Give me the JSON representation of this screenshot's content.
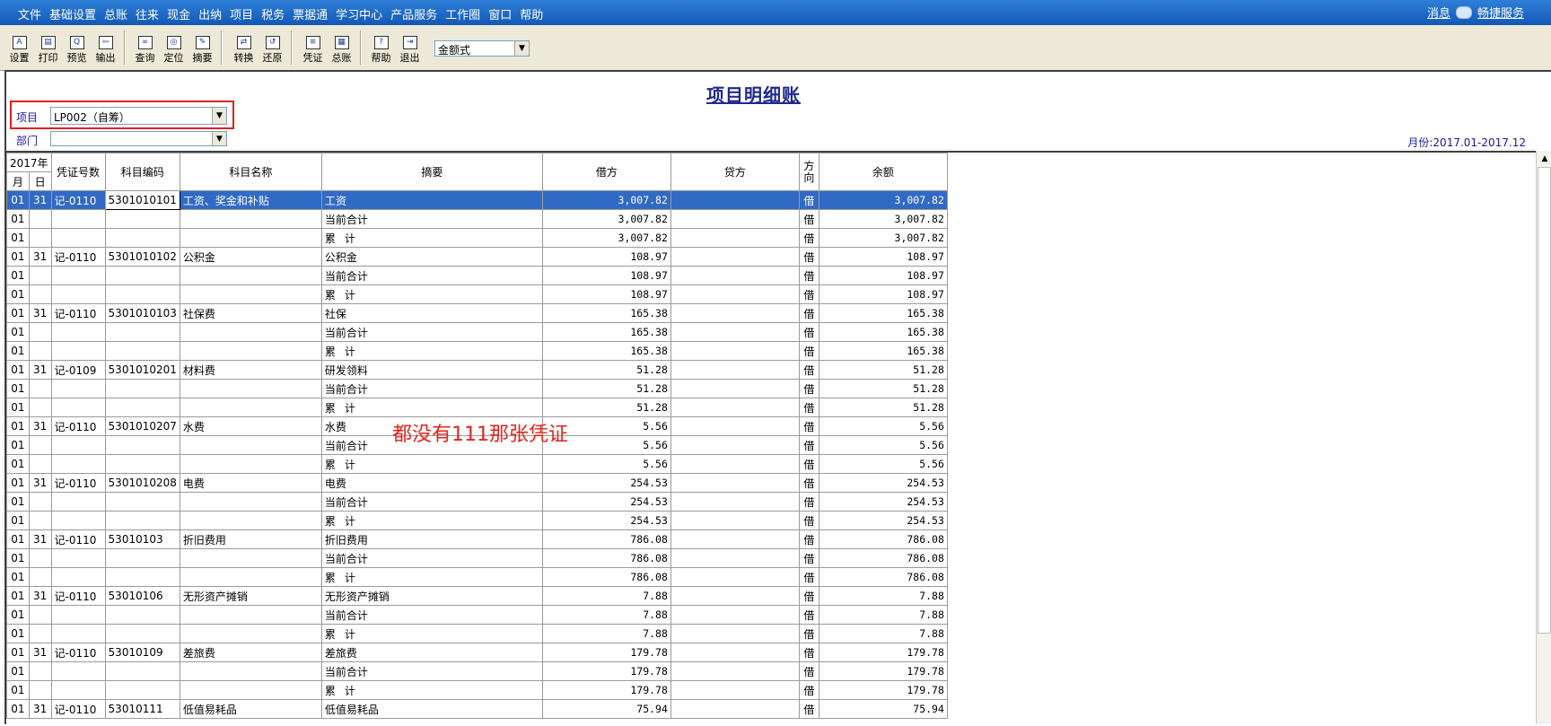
{
  "menu": {
    "items": [
      "文件",
      "基础设置",
      "总账",
      "往来",
      "现金",
      "出纳",
      "项目",
      "税务",
      "票据通",
      "学习中心",
      "产品服务",
      "工作圈",
      "窗口",
      "帮助"
    ],
    "right_message": "消息",
    "right_service": "畅捷服务"
  },
  "toolbar": {
    "groups": [
      [
        {
          "label": "设置",
          "icon": "settings-icon"
        },
        {
          "label": "打印",
          "icon": "print-icon"
        },
        {
          "label": "预览",
          "icon": "preview-icon"
        },
        {
          "label": "输出",
          "icon": "export-icon"
        }
      ],
      [
        {
          "label": "查询",
          "icon": "binoculars-icon"
        },
        {
          "label": "定位",
          "icon": "locate-icon"
        },
        {
          "label": "摘要",
          "icon": "summary-icon"
        }
      ],
      [
        {
          "label": "转换",
          "icon": "convert-icon"
        },
        {
          "label": "还原",
          "icon": "restore-icon"
        }
      ],
      [
        {
          "label": "凭证",
          "icon": "voucher-icon"
        },
        {
          "label": "总账",
          "icon": "ledger-icon"
        }
      ],
      [
        {
          "label": "帮助",
          "icon": "help-icon"
        },
        {
          "label": "退出",
          "icon": "exit-icon"
        }
      ]
    ],
    "format_select": "金额式"
  },
  "report": {
    "title": "项目明细账",
    "project_label": "项目",
    "project_value": "LP002（自筹）",
    "dept_label": "部门",
    "dept_value": "",
    "period": "月份:2017.01-2017.12"
  },
  "annotation": "都没有111那张凭证",
  "table": {
    "year_header": "2017年",
    "month_header": "月",
    "day_header": "日",
    "headers": {
      "voucher": "凭证号数",
      "code": "科目编码",
      "name": "科目名称",
      "summary": "摘要",
      "debit": "借方",
      "credit": "贷方",
      "direction": "方向",
      "balance": "余额"
    },
    "rows": [
      {
        "m": "01",
        "d": "31",
        "v": "记-0110",
        "code": "5301010101",
        "name": "工资、奖金和补贴",
        "summary": "工资",
        "debit": "3,007.82",
        "credit": "",
        "dir": "借",
        "bal": "3,007.82",
        "selected": true
      },
      {
        "m": "01",
        "d": "",
        "v": "",
        "code": "",
        "name": "",
        "summary": "当前合计",
        "debit": "3,007.82",
        "credit": "",
        "dir": "借",
        "bal": "3,007.82"
      },
      {
        "m": "01",
        "d": "",
        "v": "",
        "code": "",
        "name": "",
        "summary": "累计",
        "spaced": true,
        "debit": "3,007.82",
        "credit": "",
        "dir": "借",
        "bal": "3,007.82"
      },
      {
        "m": "01",
        "d": "31",
        "v": "记-0110",
        "code": "5301010102",
        "name": "公积金",
        "summary": "公积金",
        "debit": "108.97",
        "credit": "",
        "dir": "借",
        "bal": "108.97"
      },
      {
        "m": "01",
        "d": "",
        "v": "",
        "code": "",
        "name": "",
        "summary": "当前合计",
        "debit": "108.97",
        "credit": "",
        "dir": "借",
        "bal": "108.97"
      },
      {
        "m": "01",
        "d": "",
        "v": "",
        "code": "",
        "name": "",
        "summary": "累计",
        "spaced": true,
        "debit": "108.97",
        "credit": "",
        "dir": "借",
        "bal": "108.97"
      },
      {
        "m": "01",
        "d": "31",
        "v": "记-0110",
        "code": "5301010103",
        "name": "社保费",
        "summary": "社保",
        "debit": "165.38",
        "credit": "",
        "dir": "借",
        "bal": "165.38"
      },
      {
        "m": "01",
        "d": "",
        "v": "",
        "code": "",
        "name": "",
        "summary": "当前合计",
        "debit": "165.38",
        "credit": "",
        "dir": "借",
        "bal": "165.38"
      },
      {
        "m": "01",
        "d": "",
        "v": "",
        "code": "",
        "name": "",
        "summary": "累计",
        "spaced": true,
        "debit": "165.38",
        "credit": "",
        "dir": "借",
        "bal": "165.38"
      },
      {
        "m": "01",
        "d": "31",
        "v": "记-0109",
        "code": "5301010201",
        "name": "材料费",
        "summary": "研发领料",
        "debit": "51.28",
        "credit": "",
        "dir": "借",
        "bal": "51.28"
      },
      {
        "m": "01",
        "d": "",
        "v": "",
        "code": "",
        "name": "",
        "summary": "当前合计",
        "debit": "51.28",
        "credit": "",
        "dir": "借",
        "bal": "51.28"
      },
      {
        "m": "01",
        "d": "",
        "v": "",
        "code": "",
        "name": "",
        "summary": "累计",
        "spaced": true,
        "debit": "51.28",
        "credit": "",
        "dir": "借",
        "bal": "51.28"
      },
      {
        "m": "01",
        "d": "31",
        "v": "记-0110",
        "code": "5301010207",
        "name": "水费",
        "summary": "水费",
        "debit": "5.56",
        "credit": "",
        "dir": "借",
        "bal": "5.56"
      },
      {
        "m": "01",
        "d": "",
        "v": "",
        "code": "",
        "name": "",
        "summary": "当前合计",
        "debit": "5.56",
        "credit": "",
        "dir": "借",
        "bal": "5.56"
      },
      {
        "m": "01",
        "d": "",
        "v": "",
        "code": "",
        "name": "",
        "summary": "累计",
        "spaced": true,
        "debit": "5.56",
        "credit": "",
        "dir": "借",
        "bal": "5.56"
      },
      {
        "m": "01",
        "d": "31",
        "v": "记-0110",
        "code": "5301010208",
        "name": "电费",
        "summary": "电费",
        "debit": "254.53",
        "credit": "",
        "dir": "借",
        "bal": "254.53"
      },
      {
        "m": "01",
        "d": "",
        "v": "",
        "code": "",
        "name": "",
        "summary": "当前合计",
        "debit": "254.53",
        "credit": "",
        "dir": "借",
        "bal": "254.53"
      },
      {
        "m": "01",
        "d": "",
        "v": "",
        "code": "",
        "name": "",
        "summary": "累计",
        "spaced": true,
        "debit": "254.53",
        "credit": "",
        "dir": "借",
        "bal": "254.53"
      },
      {
        "m": "01",
        "d": "31",
        "v": "记-0110",
        "code": "53010103",
        "name": "折旧费用",
        "summary": "折旧费用",
        "debit": "786.08",
        "credit": "",
        "dir": "借",
        "bal": "786.08"
      },
      {
        "m": "01",
        "d": "",
        "v": "",
        "code": "",
        "name": "",
        "summary": "当前合计",
        "debit": "786.08",
        "credit": "",
        "dir": "借",
        "bal": "786.08"
      },
      {
        "m": "01",
        "d": "",
        "v": "",
        "code": "",
        "name": "",
        "summary": "累计",
        "spaced": true,
        "debit": "786.08",
        "credit": "",
        "dir": "借",
        "bal": "786.08"
      },
      {
        "m": "01",
        "d": "31",
        "v": "记-0110",
        "code": "53010106",
        "name": "无形资产摊销",
        "summary": "无形资产摊销",
        "debit": "7.88",
        "credit": "",
        "dir": "借",
        "bal": "7.88"
      },
      {
        "m": "01",
        "d": "",
        "v": "",
        "code": "",
        "name": "",
        "summary": "当前合计",
        "debit": "7.88",
        "credit": "",
        "dir": "借",
        "bal": "7.88"
      },
      {
        "m": "01",
        "d": "",
        "v": "",
        "code": "",
        "name": "",
        "summary": "累计",
        "spaced": true,
        "debit": "7.88",
        "credit": "",
        "dir": "借",
        "bal": "7.88"
      },
      {
        "m": "01",
        "d": "31",
        "v": "记-0110",
        "code": "53010109",
        "name": "差旅费",
        "summary": "差旅费",
        "debit": "179.78",
        "credit": "",
        "dir": "借",
        "bal": "179.78"
      },
      {
        "m": "01",
        "d": "",
        "v": "",
        "code": "",
        "name": "",
        "summary": "当前合计",
        "debit": "179.78",
        "credit": "",
        "dir": "借",
        "bal": "179.78"
      },
      {
        "m": "01",
        "d": "",
        "v": "",
        "code": "",
        "name": "",
        "summary": "累计",
        "spaced": true,
        "debit": "179.78",
        "credit": "",
        "dir": "借",
        "bal": "179.78"
      },
      {
        "m": "01",
        "d": "31",
        "v": "记-0110",
        "code": "53010111",
        "name": "低值易耗品",
        "summary": "低值易耗品",
        "debit": "75.94",
        "credit": "",
        "dir": "借",
        "bal": "75.94"
      }
    ]
  }
}
